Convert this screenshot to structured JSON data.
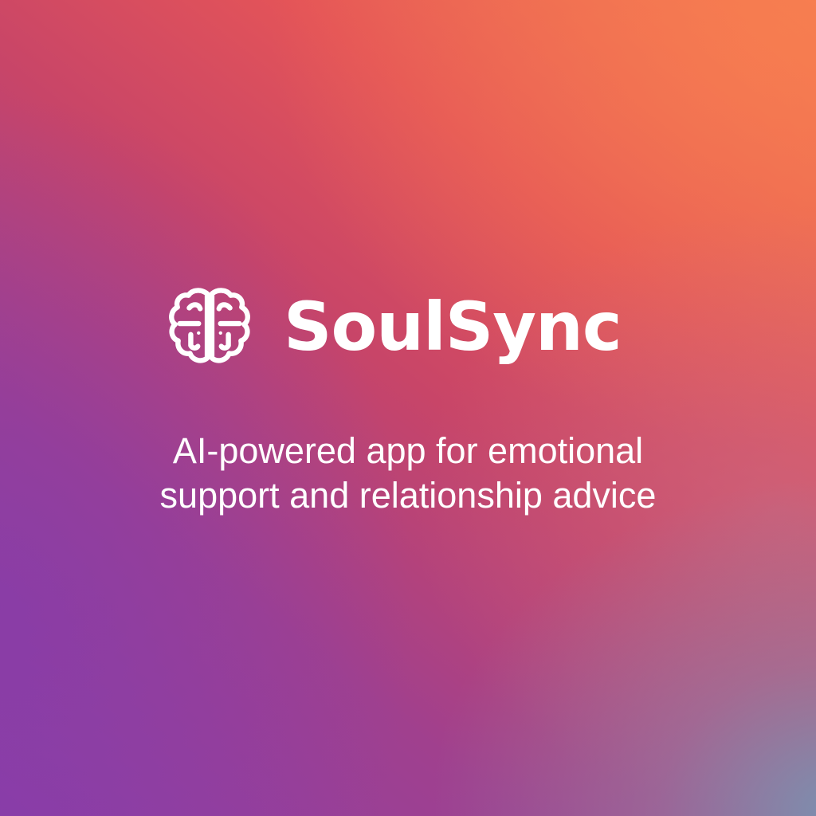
{
  "brand": {
    "name": "SoulSync",
    "icon": "brain-icon"
  },
  "tagline": {
    "line1": "AI-powered app for emotional",
    "line2": "support and relationship advice"
  },
  "colors": {
    "text": "#ffffff",
    "gradient_purple": "#8c3ea6",
    "gradient_magenta": "#c84568",
    "gradient_coral": "#e45458",
    "gradient_orange": "#f47850",
    "gradient_slate_blue": "#7696b4"
  }
}
